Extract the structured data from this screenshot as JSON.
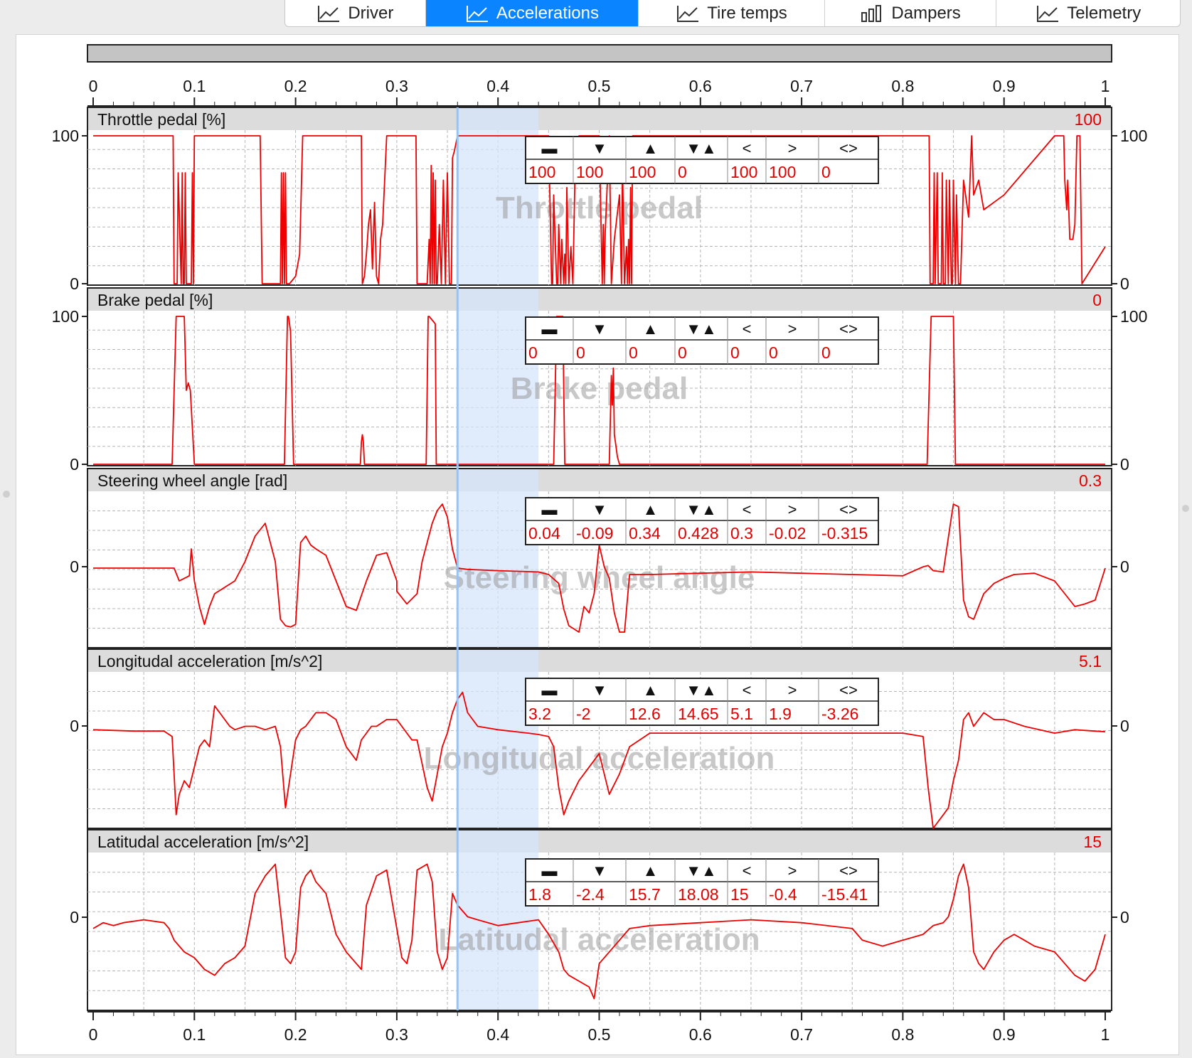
{
  "tabs": [
    {
      "id": "driver",
      "label": "Driver",
      "icon": "line-chart-icon",
      "active": false
    },
    {
      "id": "accelerations",
      "label": "Accelerations",
      "icon": "line-chart-icon",
      "active": true
    },
    {
      "id": "tire-temps",
      "label": "Tire temps",
      "icon": "line-chart-icon",
      "active": false
    },
    {
      "id": "dampers",
      "label": "Dampers",
      "icon": "bar-chart-icon",
      "active": false
    },
    {
      "id": "telemetry",
      "label": "Telemetry",
      "icon": "line-chart-icon",
      "active": false
    }
  ],
  "colors": {
    "accent": "#0a84ff",
    "series": "#ee0000",
    "selection": "#d6e6fb",
    "cursor": "#9cc3f0",
    "header_band": "#dcdcdc"
  },
  "stat_headers": [
    "▬",
    "▼",
    "▲",
    "▼▲",
    "<",
    ">",
    "<>"
  ],
  "x_axis": {
    "range": [
      0,
      1
    ],
    "ticks": [
      "0",
      "0.1",
      "0.2",
      "0.3",
      "0.4",
      "0.5",
      "0.6",
      "0.7",
      "0.8",
      "0.9",
      "1"
    ]
  },
  "cursor_position": 0.36,
  "selection_range": [
    0.36,
    0.44
  ],
  "chart_data": [
    {
      "type": "line",
      "title": "Throttle pedal [%]",
      "watermark": "Throttle pedal",
      "current": "100",
      "y_ticks": [
        "0",
        "100"
      ],
      "ylim": [
        0,
        100
      ],
      "stats": [
        "100",
        "100",
        "100",
        "0",
        "100",
        "100",
        "0"
      ],
      "x": [
        0,
        0.079,
        0.08,
        0.083,
        0.084,
        0.087,
        0.088,
        0.089,
        0.09,
        0.091,
        0.092,
        0.093,
        0.094,
        0.097,
        0.098,
        0.099,
        0.1,
        0.102,
        0.103,
        0.104,
        0.105,
        0.165,
        0.167,
        0.168,
        0.185,
        0.186,
        0.187,
        0.188,
        0.189,
        0.19,
        0.191,
        0.192,
        0.193,
        0.194,
        0.2,
        0.204,
        0.207,
        0.213,
        0.215,
        0.24,
        0.265,
        0.266,
        0.268,
        0.27,
        0.272,
        0.274,
        0.276,
        0.278,
        0.28,
        0.282,
        0.284,
        0.286,
        0.29,
        0.31,
        0.319,
        0.32,
        0.33,
        0.332,
        0.333,
        0.334,
        0.335,
        0.336,
        0.337,
        0.338,
        0.339,
        0.34,
        0.342,
        0.344,
        0.346,
        0.348,
        0.35,
        0.352,
        0.354,
        0.355,
        0.357,
        0.36,
        0.45,
        0.453,
        0.454,
        0.455,
        0.458,
        0.459,
        0.46,
        0.462,
        0.463,
        0.465,
        0.466,
        0.467,
        0.468,
        0.47,
        0.472,
        0.474,
        0.476,
        0.48,
        0.49,
        0.5,
        0.503,
        0.504,
        0.505,
        0.506,
        0.51,
        0.512,
        0.515,
        0.52,
        0.522,
        0.523,
        0.525,
        0.527,
        0.528,
        0.529,
        0.53,
        0.531,
        0.532,
        0.533,
        0.54,
        0.6,
        0.7,
        0.8,
        0.826,
        0.827,
        0.83,
        0.831,
        0.832,
        0.834,
        0.835,
        0.838,
        0.839,
        0.84,
        0.842,
        0.843,
        0.845,
        0.846,
        0.848,
        0.849,
        0.85,
        0.852,
        0.853,
        0.855,
        0.857,
        0.86,
        0.865,
        0.868,
        0.87,
        0.875,
        0.88,
        0.9,
        0.95,
        0.952,
        0.955,
        0.957,
        0.959,
        0.96,
        0.962,
        0.963,
        0.965,
        0.968,
        0.97,
        0.972,
        0.975,
        0.977,
        1
      ],
      "y": [
        100,
        100,
        0,
        0,
        75,
        0,
        75,
        0,
        0,
        75,
        0,
        0,
        0,
        0,
        75,
        0,
        100,
        100,
        100,
        100,
        100,
        100,
        0,
        0,
        0,
        75,
        0,
        75,
        0,
        75,
        0,
        0,
        0,
        0,
        5,
        20,
        100,
        100,
        100,
        100,
        100,
        0,
        5,
        20,
        40,
        50,
        10,
        55,
        5,
        0,
        30,
        40,
        100,
        100,
        100,
        0,
        0,
        30,
        0,
        80,
        0,
        75,
        0,
        70,
        0,
        0,
        40,
        0,
        70,
        0,
        75,
        0,
        0,
        85,
        90,
        100,
        100,
        0,
        0,
        60,
        0,
        0,
        40,
        0,
        30,
        0,
        20,
        0,
        65,
        0,
        25,
        0,
        70,
        100,
        100,
        100,
        0,
        40,
        0,
        35,
        100,
        0,
        30,
        60,
        0,
        80,
        0,
        25,
        0,
        30,
        0,
        65,
        0,
        100,
        100,
        100,
        100,
        100,
        100,
        0,
        0,
        75,
        0,
        75,
        0,
        0,
        75,
        0,
        0,
        70,
        0,
        70,
        0,
        0,
        70,
        0,
        60,
        0,
        0,
        70,
        45,
        100,
        60,
        70,
        50,
        60,
        100,
        100,
        100,
        100,
        100,
        70,
        50,
        70,
        30,
        30,
        40,
        100,
        100,
        0,
        25,
        100,
        100
      ]
    },
    {
      "type": "line",
      "title": "Brake pedal [%]",
      "watermark": "Brake pedal",
      "current": "0",
      "y_ticks": [
        "0",
        "100"
      ],
      "ylim": [
        0,
        100
      ],
      "stats": [
        "0",
        "0",
        "0",
        "0",
        "0",
        "0",
        "0"
      ],
      "x": [
        0,
        0.078,
        0.082,
        0.083,
        0.09,
        0.092,
        0.094,
        0.096,
        0.1,
        0.103,
        0.189,
        0.192,
        0.193,
        0.195,
        0.198,
        0.2,
        0.264,
        0.265,
        0.266,
        0.267,
        0.268,
        0.329,
        0.331,
        0.332,
        0.338,
        0.339,
        0.341,
        0.42,
        0.455,
        0.458,
        0.459,
        0.464,
        0.466,
        0.47,
        0.5,
        0.51,
        0.512,
        0.513,
        0.514,
        0.515,
        0.516,
        0.518,
        0.52,
        0.522,
        0.6,
        0.8,
        0.824,
        0.828,
        0.848,
        0.85,
        0.852,
        0.9,
        1
      ],
      "y": [
        0,
        0,
        100,
        100,
        100,
        50,
        55,
        50,
        0,
        0,
        0,
        100,
        100,
        90,
        0,
        0,
        0,
        15,
        20,
        15,
        0,
        0,
        100,
        100,
        95,
        0,
        0,
        0,
        0,
        100,
        100,
        100,
        0,
        0,
        0,
        0,
        60,
        40,
        65,
        20,
        15,
        5,
        0,
        0,
        0,
        0,
        0,
        100,
        100,
        100,
        0,
        0,
        0
      ]
    },
    {
      "type": "line",
      "title": "Steering wheel angle [rad]",
      "watermark": "Steering wheel angle",
      "current": "0.3",
      "y_ticks": [
        "0"
      ],
      "ylim": [
        -0.6,
        0.6
      ],
      "stats": [
        "0.04",
        "-0.09",
        "0.34",
        "0.428",
        "0.3",
        "-0.02",
        "-0.315"
      ],
      "x": [
        0,
        0.03,
        0.06,
        0.075,
        0.08,
        0.085,
        0.09,
        0.095,
        0.097,
        0.1,
        0.105,
        0.11,
        0.115,
        0.12,
        0.13,
        0.14,
        0.15,
        0.16,
        0.165,
        0.17,
        0.18,
        0.185,
        0.19,
        0.195,
        0.2,
        0.205,
        0.21,
        0.215,
        0.22,
        0.23,
        0.24,
        0.25,
        0.26,
        0.27,
        0.28,
        0.29,
        0.3,
        0.3,
        0.31,
        0.32,
        0.325,
        0.33,
        0.335,
        0.34,
        0.345,
        0.35,
        0.355,
        0.36,
        0.37,
        0.4,
        0.44,
        0.45,
        0.46,
        0.465,
        0.47,
        0.48,
        0.485,
        0.49,
        0.495,
        0.5,
        0.505,
        0.51,
        0.515,
        0.52,
        0.525,
        0.53,
        0.55,
        0.6,
        0.65,
        0.7,
        0.75,
        0.8,
        0.82,
        0.825,
        0.83,
        0.84,
        0.848,
        0.85,
        0.855,
        0.86,
        0.865,
        0.87,
        0.875,
        0.88,
        0.89,
        0.9,
        0.91,
        0.93,
        0.95,
        0.96,
        0.97,
        0.98,
        0.99,
        1
      ],
      "y": [
        0,
        0,
        0,
        0,
        0,
        -0.1,
        -0.08,
        -0.06,
        0.15,
        -0.1,
        -0.3,
        -0.44,
        -0.3,
        -0.2,
        -0.15,
        -0.1,
        0.05,
        0.25,
        0.3,
        0.35,
        0.05,
        -0.4,
        -0.45,
        -0.46,
        -0.44,
        0.2,
        0.25,
        0.18,
        0.15,
        0.1,
        -0.1,
        -0.3,
        -0.33,
        -0.1,
        0.1,
        0.12,
        -0.1,
        -0.18,
        -0.28,
        -0.2,
        0.05,
        0.2,
        0.35,
        0.45,
        0.5,
        0.4,
        0.15,
        0,
        -0.01,
        -0.02,
        -0.03,
        -0.05,
        -0.12,
        -0.32,
        -0.45,
        -0.5,
        -0.3,
        -0.35,
        -0.2,
        0.18,
        0.01,
        -0.08,
        -0.35,
        -0.5,
        -0.5,
        -0.05,
        -0.05,
        -0.04,
        -0.03,
        -0.04,
        -0.05,
        -0.06,
        0.01,
        0.02,
        -0.02,
        -0.03,
        0.4,
        0.5,
        0.48,
        -0.25,
        -0.38,
        -0.4,
        -0.3,
        -0.2,
        -0.12,
        -0.08,
        -0.05,
        -0.04,
        -0.1,
        -0.2,
        -0.3,
        -0.28,
        -0.25,
        0
      ]
    },
    {
      "type": "line",
      "title": "Longitudal acceleration [m/s^2]",
      "watermark": "Longitudal acceleration",
      "current": "5.1",
      "y_ticks": [
        "0"
      ],
      "ylim": [
        -14,
        9
      ],
      "stats": [
        "3.2",
        "-2",
        "12.6",
        "14.65",
        "5.1",
        "1.9",
        "-3.26"
      ],
      "x": [
        0,
        0.04,
        0.07,
        0.078,
        0.08,
        0.082,
        0.085,
        0.09,
        0.095,
        0.1,
        0.105,
        0.11,
        0.115,
        0.12,
        0.125,
        0.13,
        0.135,
        0.14,
        0.15,
        0.16,
        0.17,
        0.18,
        0.185,
        0.19,
        0.192,
        0.195,
        0.2,
        0.205,
        0.21,
        0.215,
        0.22,
        0.23,
        0.24,
        0.25,
        0.26,
        0.265,
        0.27,
        0.275,
        0.28,
        0.29,
        0.3,
        0.31,
        0.315,
        0.32,
        0.33,
        0.335,
        0.34,
        0.345,
        0.35,
        0.355,
        0.36,
        0.365,
        0.37,
        0.38,
        0.4,
        0.43,
        0.44,
        0.45,
        0.455,
        0.46,
        0.465,
        0.47,
        0.48,
        0.49,
        0.5,
        0.51,
        0.52,
        0.525,
        0.53,
        0.55,
        0.6,
        0.65,
        0.7,
        0.75,
        0.8,
        0.82,
        0.825,
        0.83,
        0.835,
        0.84,
        0.845,
        0.85,
        0.855,
        0.86,
        0.865,
        0.87,
        0.88,
        0.89,
        0.9,
        0.92,
        0.95,
        0.97,
        1
      ],
      "y": [
        0.5,
        0.3,
        0.3,
        -0.5,
        -6,
        -12,
        -9,
        -7,
        -8,
        -5,
        -2,
        -1,
        -2,
        4,
        3,
        2,
        1,
        0.5,
        1,
        1,
        0.5,
        1,
        -2,
        -11,
        -9,
        -6,
        -1,
        0.5,
        1,
        2,
        3,
        3,
        2,
        -2,
        -4,
        -1,
        0,
        1,
        1,
        2,
        2,
        0,
        -1,
        -1,
        -8,
        -10,
        -6,
        -2,
        0,
        3,
        5,
        6,
        3,
        1,
        0.5,
        0,
        -0.2,
        -0.5,
        -2,
        -8,
        -12,
        -10,
        -7,
        -5,
        -3,
        -9,
        -6,
        -4,
        -2,
        0,
        0,
        0,
        0,
        0,
        0,
        -0.5,
        -8,
        -14,
        -13,
        -12,
        -11,
        -7,
        -4,
        2,
        3,
        1,
        3,
        2,
        2,
        1,
        0,
        0.5,
        0.2
      ]
    },
    {
      "type": "line",
      "title": "Latitudal acceleration [m/s^2]",
      "watermark": "Latitudal acceleration",
      "current": "15",
      "y_ticks": [
        "0"
      ],
      "ylim": [
        -15,
        12
      ],
      "stats": [
        "1.8",
        "-2.4",
        "15.7",
        "18.08",
        "15",
        "-0.4",
        "-15.41"
      ],
      "x": [
        0,
        0.01,
        0.02,
        0.03,
        0.05,
        0.07,
        0.075,
        0.08,
        0.085,
        0.09,
        0.1,
        0.11,
        0.12,
        0.13,
        0.14,
        0.15,
        0.16,
        0.17,
        0.175,
        0.18,
        0.185,
        0.19,
        0.195,
        0.2,
        0.205,
        0.21,
        0.215,
        0.22,
        0.23,
        0.24,
        0.25,
        0.26,
        0.265,
        0.27,
        0.28,
        0.29,
        0.3,
        0.305,
        0.31,
        0.315,
        0.32,
        0.33,
        0.335,
        0.34,
        0.345,
        0.35,
        0.355,
        0.36,
        0.37,
        0.38,
        0.4,
        0.42,
        0.44,
        0.45,
        0.46,
        0.465,
        0.47,
        0.48,
        0.49,
        0.495,
        0.5,
        0.51,
        0.52,
        0.53,
        0.55,
        0.6,
        0.65,
        0.7,
        0.75,
        0.76,
        0.78,
        0.8,
        0.82,
        0.83,
        0.84,
        0.845,
        0.85,
        0.855,
        0.86,
        0.865,
        0.87,
        0.875,
        0.88,
        0.89,
        0.9,
        0.91,
        0.92,
        0.93,
        0.95,
        0.96,
        0.97,
        0.98,
        0.99,
        1
      ],
      "y": [
        -1,
        0,
        -0.5,
        0,
        0.5,
        0,
        -1,
        -3,
        -4,
        -5,
        -6,
        -8,
        -9,
        -7,
        -6,
        -4,
        5,
        8,
        9,
        10,
        2,
        -6,
        -7,
        -5,
        6,
        8,
        9,
        7,
        5,
        -2,
        -5,
        -7,
        -8,
        3,
        8,
        9,
        -1,
        -6,
        -7,
        -3,
        9,
        10,
        7,
        -5,
        -8,
        -6,
        5,
        3,
        1,
        0.5,
        -0.5,
        0,
        0.5,
        -2,
        -5,
        -8,
        -9,
        -10,
        -11,
        -13,
        -7,
        -5,
        -3,
        -1,
        -0.5,
        0,
        0.5,
        0,
        -1,
        -3,
        -4,
        -3,
        -2,
        -0.5,
        0,
        1,
        4,
        8,
        10,
        6,
        -5,
        -7,
        -8,
        -5,
        -3,
        -2,
        -3,
        -4,
        -5,
        -7,
        -9,
        -10,
        -8,
        -2
      ]
    }
  ]
}
